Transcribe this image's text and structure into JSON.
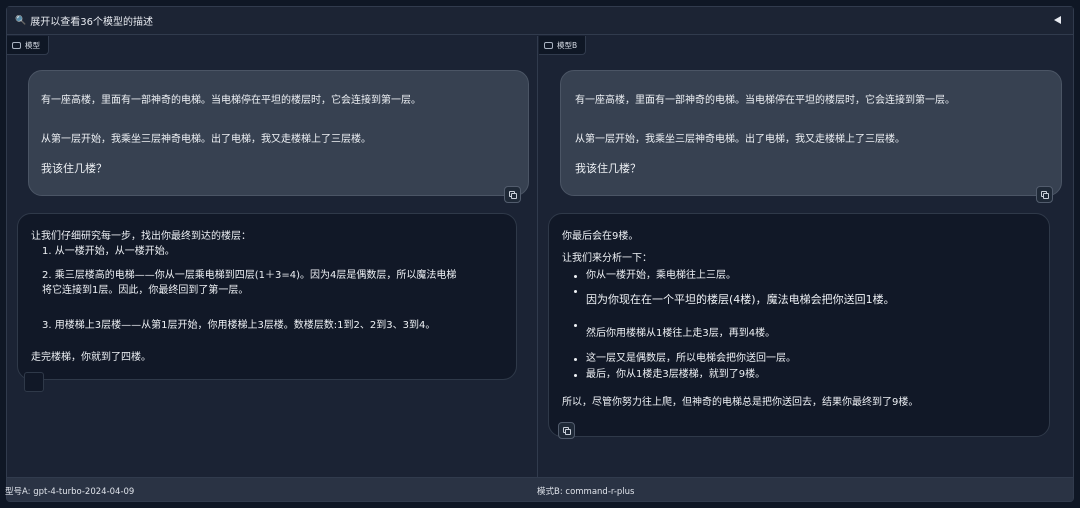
{
  "header": {
    "title": "展开以查看36个模型的描述"
  },
  "left": {
    "tag": "模型",
    "prompt": {
      "line1": "有一座高楼，里面有一部神奇的电梯。当电梯停在平坦的楼层时，它会连接到第一层。",
      "line2": "从第一层开始，我乘坐三层神奇电梯。出了电梯，我又走楼梯上了三层楼。",
      "line3": "我该住几楼？"
    },
    "response": {
      "intro": "让我们仔细研究每一步，找出你最终到达的楼层：",
      "step1": "1. 从一楼开始，从一楼开始。",
      "step2a": "2. 乘三层楼高的电梯——你从一层乘电梯到四层(1＋3=4)。因为4层是偶数层，所以魔法电梯",
      "step2b": "将它连接到1层。因此，你最终回到了第一层。",
      "step3": "3. 用楼梯上3层楼——从第1层开始，你用楼梯上3层楼。数楼层数:1到2、2到3、3到4。",
      "conclusion": "走完楼梯，你就到了四楼。"
    },
    "footer": "型号A: gpt-4-turbo-2024-04-09"
  },
  "right": {
    "tag": "模型B",
    "prompt": {
      "line1": "有一座高楼，里面有一部神奇的电梯。当电梯停在平坦的楼层时，它会连接到第一层。",
      "line2": "从第一层开始，我乘坐三层神奇电梯。出了电梯，我又走楼梯上了三层楼。",
      "line3": "我该住几楼？"
    },
    "response": {
      "answer": "你最后会在9楼。",
      "intro": "让我们来分析一下：",
      "b1": "你从一楼开始，乘电梯往上三层。",
      "b2": "因为你现在在一个平坦的楼层(4楼)，魔法电梯会把你送回1楼。",
      "b3": "然后你用楼梯从1楼往上走3层，再到4楼。",
      "b4": "这一层又是偶数层，所以电梯会把你送回一层。",
      "b5": "最后，你从1楼走3层楼梯，就到了9楼。",
      "conclusion": "所以，尽管你努力往上爬，但神奇的电梯总是把你送回去，结果你最终到了9楼。"
    },
    "footer": "模式B: command-r-plus"
  }
}
